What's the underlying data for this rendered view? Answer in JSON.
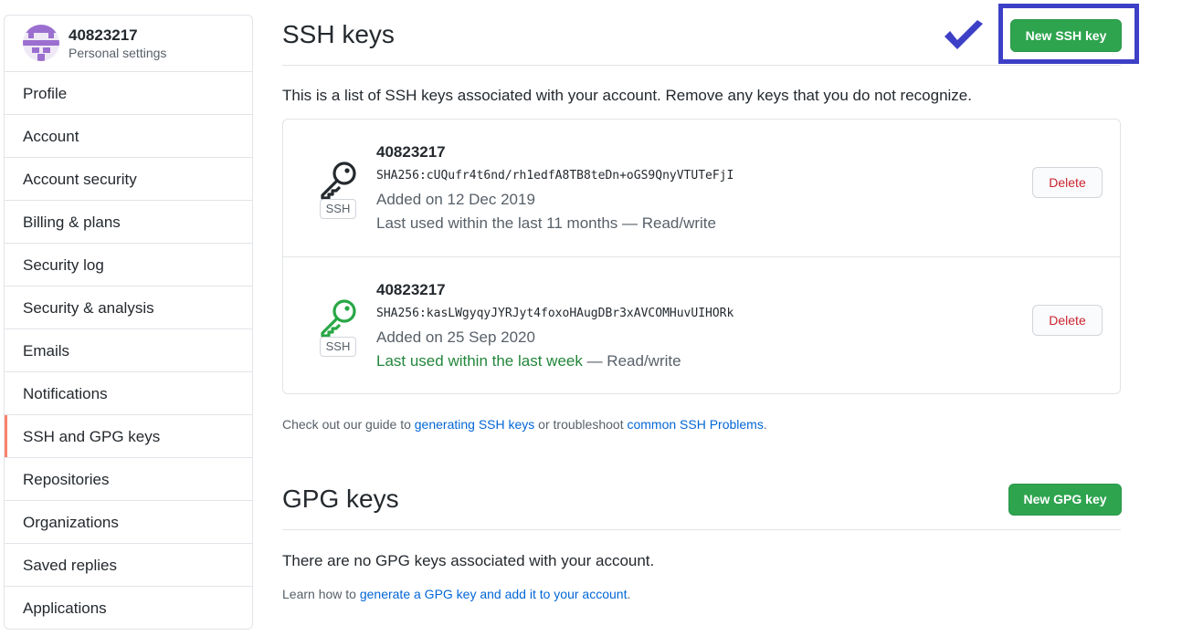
{
  "profile": {
    "username": "40823217",
    "subtitle": "Personal settings"
  },
  "nav": [
    {
      "label": "Profile",
      "active": false
    },
    {
      "label": "Account",
      "active": false
    },
    {
      "label": "Account security",
      "active": false
    },
    {
      "label": "Billing & plans",
      "active": false
    },
    {
      "label": "Security log",
      "active": false
    },
    {
      "label": "Security & analysis",
      "active": false
    },
    {
      "label": "Emails",
      "active": false
    },
    {
      "label": "Notifications",
      "active": false
    },
    {
      "label": "SSH and GPG keys",
      "active": true
    },
    {
      "label": "Repositories",
      "active": false
    },
    {
      "label": "Organizations",
      "active": false
    },
    {
      "label": "Saved replies",
      "active": false
    },
    {
      "label": "Applications",
      "active": false
    }
  ],
  "ssh": {
    "title": "SSH keys",
    "new_button": "New SSH key",
    "intro": "This is a list of SSH keys associated with your account. Remove any keys that you do not recognize.",
    "keys": [
      {
        "title": "40823217",
        "fingerprint": "SHA256:cUQufr4t6nd/rh1edfA8TB8teDn+oGS9QnyVTUTeFjI",
        "added": "Added on 12 Dec 2019",
        "used_prefix": "Last used within the last 11 months",
        "used_recent": "",
        "used_suffix": " — Read/write",
        "badge": "SSH",
        "delete_label": "Delete",
        "icon_color": "#24292e"
      },
      {
        "title": "40823217",
        "fingerprint": "SHA256:kasLWgyqyJYRJyt4foxoHAugDBr3xAVCOMHuvUIHORk",
        "added": "Added on 25 Sep 2020",
        "used_prefix": "",
        "used_recent": "Last used within the last week",
        "used_suffix": " — Read/write",
        "badge": "SSH",
        "delete_label": "Delete",
        "icon_color": "#28a745"
      }
    ],
    "guide_prefix": "Check out our guide to ",
    "guide_link1": "generating SSH keys",
    "guide_middle": " or troubleshoot ",
    "guide_link2": "common SSH Problems",
    "guide_suffix": "."
  },
  "gpg": {
    "title": "GPG keys",
    "new_button": "New GPG key",
    "empty": "There are no GPG keys associated with your account.",
    "learn_prefix": "Learn how to ",
    "learn_link": "generate a GPG key and add it to your account",
    "learn_suffix": "."
  },
  "colors": {
    "primary_green": "#2ea44f",
    "highlight": "#3d40c6",
    "link": "#0366d6",
    "danger": "#cb2431",
    "active_nav_bar": "#f9826c"
  },
  "icons": {
    "check": "checkmark-icon",
    "key": "key-icon"
  }
}
